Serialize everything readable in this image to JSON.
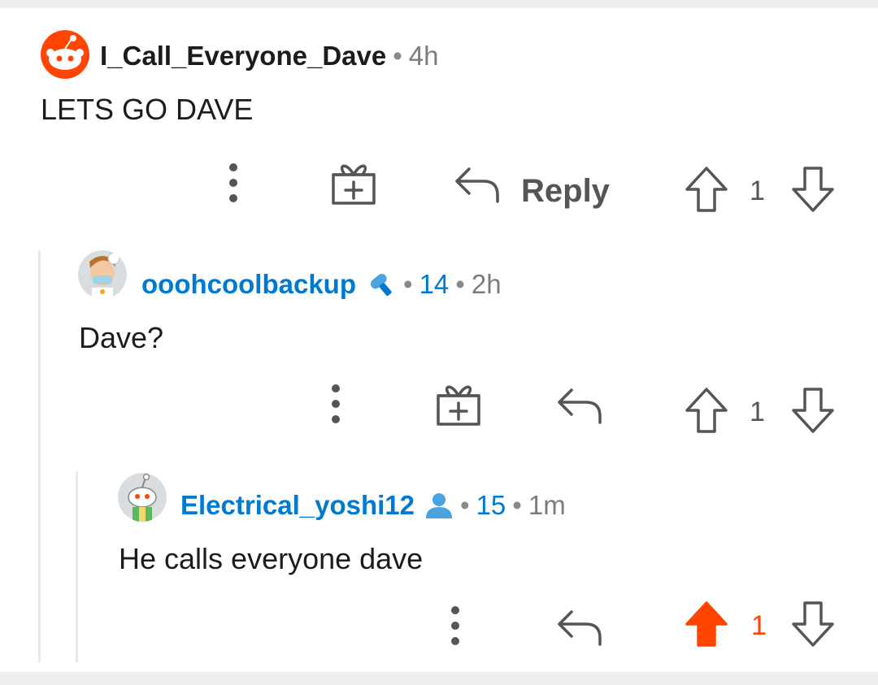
{
  "comments": [
    {
      "username": "I_Call_Everyone_Dave",
      "separator": "•",
      "age": "4h",
      "text": "LETS GO DAVE",
      "actions": {
        "reply_label": "Reply",
        "vote_count": "1",
        "upvoted": false
      }
    },
    {
      "username": "ooohcoolbackup",
      "flair_icon": "microphone-icon",
      "separator": "•",
      "score": "14",
      "age": "2h",
      "text": "Dave?",
      "actions": {
        "vote_count": "1",
        "upvoted": false
      }
    },
    {
      "username": "Electrical_yoshi12",
      "flair_icon": "user-icon",
      "separator": "•",
      "score": "15",
      "age": "1m",
      "text": "He calls everyone dave",
      "actions": {
        "vote_count": "1",
        "upvoted": true
      }
    }
  ],
  "colors": {
    "upvote_active": "#ff4500",
    "username_blue": "#0079d3",
    "icon_gray": "#555555"
  }
}
